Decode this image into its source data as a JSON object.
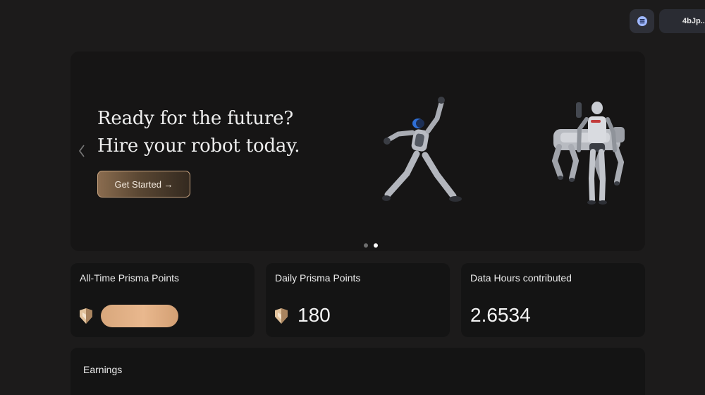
{
  "header": {
    "menu_icon": "list-icon",
    "wallet_label": "4bJp..."
  },
  "hero": {
    "title_line1": "Ready for the future?",
    "title_line2": "Hire your robot today.",
    "cta_label": "Get Started →",
    "slide_count": 2,
    "active_slide": 2
  },
  "stats": [
    {
      "label": "All-Time Prisma Points",
      "value": "",
      "icon": "prisma-badge-icon"
    },
    {
      "label": "Daily Prisma Points",
      "value": "180",
      "icon": "prisma-badge-icon"
    },
    {
      "label": "Data Hours contributed",
      "value": "2.6534"
    }
  ],
  "earnings": {
    "label": "Earnings"
  },
  "colors": {
    "background": "#1c1b1b",
    "card": "#141414",
    "accent_bronze": "#c7a37f"
  }
}
